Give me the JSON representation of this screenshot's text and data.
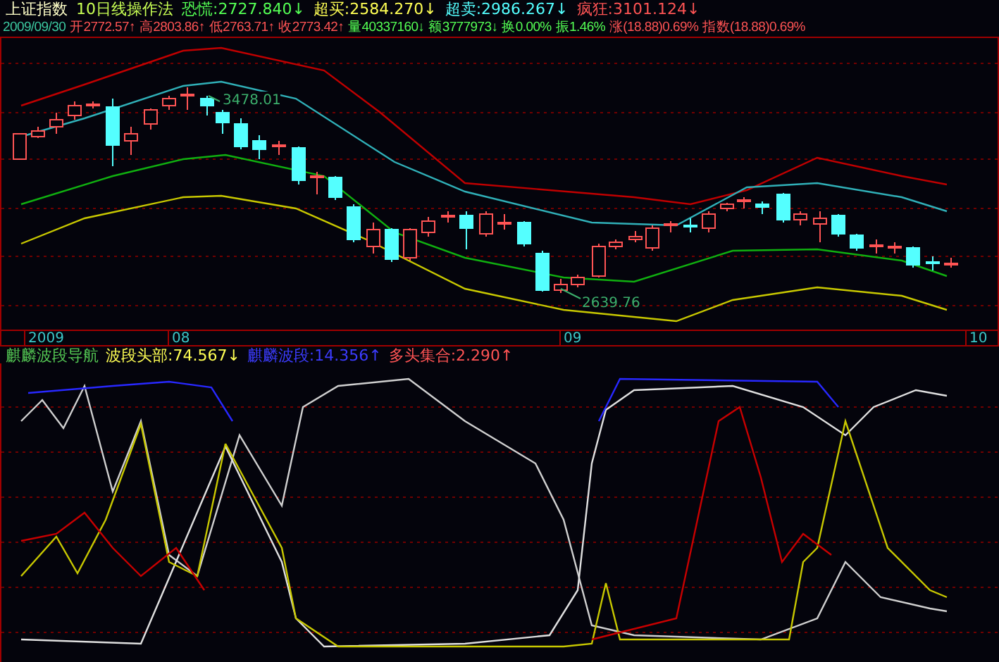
{
  "header": {
    "title": "上证指数",
    "method": "10日线操作法",
    "indicators": [
      {
        "text": "恐慌:2727.840",
        "arrow": "↓",
        "color": "#54ff54"
      },
      {
        "text": "超买:2584.270",
        "arrow": "↓",
        "color": "#ffff54"
      },
      {
        "text": "超卖:2986.267",
        "arrow": "↓",
        "color": "#54ffff"
      },
      {
        "text": "疯狂:3101.124",
        "arrow": "↓",
        "color": "#ff5454"
      }
    ]
  },
  "quote": {
    "date": "2009/09/30",
    "items": [
      {
        "text": "开2772.57",
        "arrow": "↑",
        "color": "#ff5454"
      },
      {
        "text": "高2803.86",
        "arrow": "↑",
        "color": "#ff5454"
      },
      {
        "text": "低2763.71",
        "arrow": "↑",
        "color": "#ff5454"
      },
      {
        "text": "收2773.42",
        "arrow": "↑",
        "color": "#ff5454"
      },
      {
        "text": "量40337160",
        "arrow": "↓",
        "color": "#54ff54"
      },
      {
        "text": "额3777973",
        "arrow": "↓",
        "color": "#54ff54"
      },
      {
        "text": "换0.00%",
        "color": "#54ff54"
      },
      {
        "text": "振1.46%",
        "color": "#54ff54"
      },
      {
        "text": "涨(18.88)0.69%",
        "color": "#ff5454"
      },
      {
        "text": "指数(18.88)0.69%",
        "color": "#ff5454"
      }
    ]
  },
  "price_chart": {
    "high_label": "3478.01",
    "low_label": "2639.76"
  },
  "date_axis": [
    "2009",
    "08",
    "09",
    "10"
  ],
  "indicator_panel": {
    "title": "麒麟波段导航",
    "items": [
      {
        "text": "波段头部:74.567",
        "arrow": "↓",
        "color": "#ffff54"
      },
      {
        "text": "麒麟波段:14.356",
        "arrow": "↑",
        "color": "#3c3cff"
      },
      {
        "text": "多头集合:2.290",
        "arrow": "↑",
        "color": "#ff5454"
      }
    ]
  }
}
